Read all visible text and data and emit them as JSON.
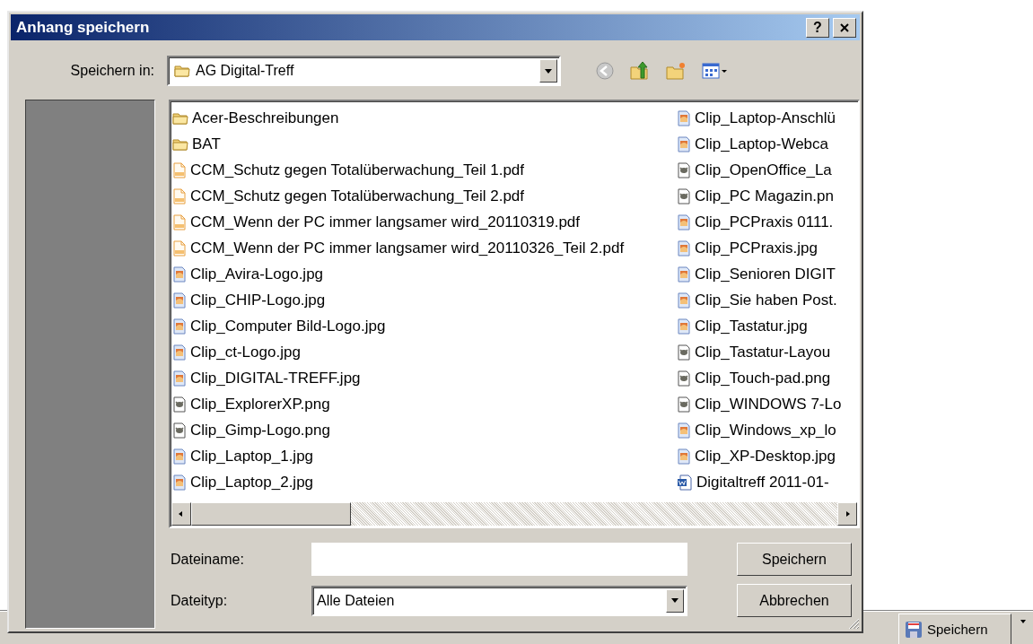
{
  "window": {
    "title": "Anhang speichern",
    "help": "?"
  },
  "save_in": {
    "label": "Speichern in:",
    "value": "AG Digital-Treff"
  },
  "files": [
    {
      "name": "Acer-Beschreibungen",
      "kind": "folder"
    },
    {
      "name": "BAT",
      "kind": "folder"
    },
    {
      "name": "CCM_Schutz gegen Totalüberwachung_Teil 1.pdf",
      "kind": "pdf"
    },
    {
      "name": "CCM_Schutz gegen Totalüberwachung_Teil 2.pdf",
      "kind": "pdf"
    },
    {
      "name": "CCM_Wenn der PC immer langsamer wird_20110319.pdf",
      "kind": "pdf"
    },
    {
      "name": "CCM_Wenn der PC immer langsamer wird_20110326_Teil 2.pdf",
      "kind": "pdf"
    },
    {
      "name": "Clip_Avira-Logo.jpg",
      "kind": "jpg"
    },
    {
      "name": "Clip_CHIP-Logo.jpg",
      "kind": "jpg"
    },
    {
      "name": "Clip_Computer Bild-Logo.jpg",
      "kind": "jpg"
    },
    {
      "name": "Clip_ct-Logo.jpg",
      "kind": "jpg"
    },
    {
      "name": "Clip_DIGITAL-TREFF.jpg",
      "kind": "jpg"
    },
    {
      "name": "Clip_ExplorerXP.png",
      "kind": "png"
    },
    {
      "name": "Clip_Gimp-Logo.png",
      "kind": "png"
    },
    {
      "name": "Clip_Laptop_1.jpg",
      "kind": "jpg"
    },
    {
      "name": "Clip_Laptop_2.jpg",
      "kind": "jpg"
    },
    {
      "name": "Clip_Laptop-Anschlü",
      "kind": "jpg"
    },
    {
      "name": "Clip_Laptop-Webca",
      "kind": "jpg"
    },
    {
      "name": "Clip_OpenOffice_La",
      "kind": "png"
    },
    {
      "name": "Clip_PC Magazin.pn",
      "kind": "png"
    },
    {
      "name": "Clip_PCPraxis 0111.",
      "kind": "jpg"
    },
    {
      "name": "Clip_PCPraxis.jpg",
      "kind": "jpg"
    },
    {
      "name": "Clip_Senioren DIGIT",
      "kind": "jpg"
    },
    {
      "name": "Clip_Sie haben Post.",
      "kind": "jpg"
    },
    {
      "name": "Clip_Tastatur.jpg",
      "kind": "jpg"
    },
    {
      "name": "Clip_Tastatur-Layou",
      "kind": "png"
    },
    {
      "name": "Clip_Touch-pad.png",
      "kind": "png"
    },
    {
      "name": "Clip_WINDOWS 7-Lo",
      "kind": "png"
    },
    {
      "name": "Clip_Windows_xp_lo",
      "kind": "jpg"
    },
    {
      "name": "Clip_XP-Desktop.jpg",
      "kind": "jpg"
    },
    {
      "name": "Digitaltreff 2011-01-",
      "kind": "doc"
    }
  ],
  "file_name": {
    "label": "Dateiname:"
  },
  "file_type": {
    "label": "Dateityp:",
    "value": "Alle Dateien"
  },
  "buttons": [
    "Speichern",
    "Abbrechen"
  ],
  "toolbar": {
    "save_button": "Speichern"
  }
}
